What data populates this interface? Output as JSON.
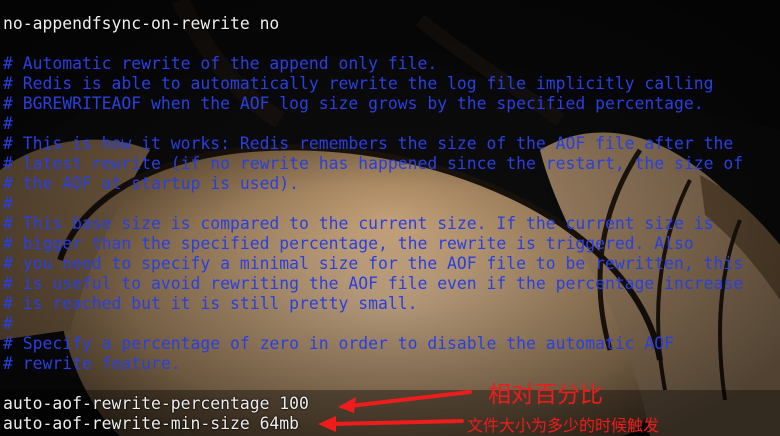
{
  "terminal": {
    "lines": [
      {
        "text": "no-appendfsync-on-rewrite no",
        "kind": "white"
      },
      {
        "text": "",
        "kind": "blank"
      },
      {
        "text": "# Automatic rewrite of the append only file.",
        "kind": "comment"
      },
      {
        "text": "# Redis is able to automatically rewrite the log file implicitly calling",
        "kind": "comment"
      },
      {
        "text": "# BGREWRITEAOF when the AOF log size grows by the specified percentage.",
        "kind": "comment"
      },
      {
        "text": "#",
        "kind": "comment"
      },
      {
        "text": "# This is how it works: Redis remembers the size of the AOF file after the",
        "kind": "comment"
      },
      {
        "text": "# latest rewrite (if no rewrite has happened since the restart, the size of",
        "kind": "comment"
      },
      {
        "text": "# the AOF at startup is used).",
        "kind": "comment"
      },
      {
        "text": "#",
        "kind": "comment"
      },
      {
        "text": "# This base size is compared to the current size. If the current size is",
        "kind": "comment"
      },
      {
        "text": "# bigger than the specified percentage, the rewrite is triggered. Also",
        "kind": "comment"
      },
      {
        "text": "# you need to specify a minimal size for the AOF file to be rewritten, this",
        "kind": "comment"
      },
      {
        "text": "# is useful to avoid rewriting the AOF file even if the percentage increase",
        "kind": "comment"
      },
      {
        "text": "# is reached but it is still pretty small.",
        "kind": "comment"
      },
      {
        "text": "#",
        "kind": "comment"
      },
      {
        "text": "# Specify a percentage of zero in order to disable the automatic AOF",
        "kind": "comment"
      },
      {
        "text": "# rewrite feature.",
        "kind": "comment"
      },
      {
        "text": "",
        "kind": "blank"
      },
      {
        "text": "auto-aof-rewrite-percentage 100",
        "kind": "white"
      },
      {
        "text": "auto-aof-rewrite-min-size 64mb",
        "kind": "white"
      }
    ]
  },
  "annotations": {
    "percentage_note": "相对百分比",
    "min_size_note": "文件大小为多少的时候触发"
  },
  "colors": {
    "comment": "#2a3fe0",
    "config_text": "#eeeeee",
    "annotation": "#ee1c1c"
  },
  "background": {
    "description_icon": "cartoon-wallpaper-image"
  }
}
